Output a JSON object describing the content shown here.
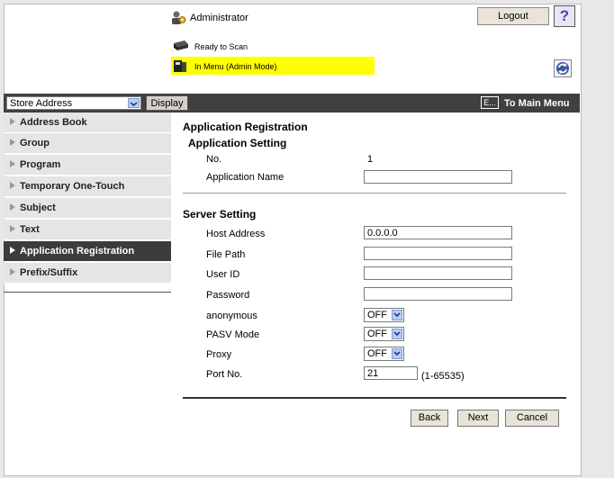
{
  "header": {
    "user_label": "Administrator",
    "logout_label": "Logout",
    "help_label": "?",
    "status_ready": "Ready to Scan",
    "status_mode": "In Menu (Admin Mode)"
  },
  "toolbar": {
    "store_select_value": "Store Address",
    "display_label": "Display",
    "menu_icon_label": "E...",
    "to_main_menu_label": "To Main Menu"
  },
  "sidebar": {
    "items": [
      {
        "label": "Address Book"
      },
      {
        "label": "Group"
      },
      {
        "label": "Program"
      },
      {
        "label": "Temporary One-Touch"
      },
      {
        "label": "Subject"
      },
      {
        "label": "Text"
      },
      {
        "label": "Application Registration",
        "active": true
      },
      {
        "label": "Prefix/Suffix"
      }
    ]
  },
  "main": {
    "title": "Application Registration",
    "application_setting": {
      "heading": "Application Setting",
      "no_label": "No.",
      "no_value": "1",
      "app_name_label": "Application Name",
      "app_name_value": ""
    },
    "server_setting": {
      "heading": "Server Setting",
      "host_label": "Host Address",
      "host_value": "0.0.0.0",
      "file_path_label": "File Path",
      "file_path_value": "",
      "user_id_label": "User ID",
      "user_id_value": "",
      "password_label": "Password",
      "password_value": "",
      "anonymous_label": "anonymous",
      "anonymous_value": "OFF",
      "pasv_label": "PASV Mode",
      "pasv_value": "OFF",
      "proxy_label": "Proxy",
      "proxy_value": "OFF",
      "port_label": "Port No.",
      "port_value": "21",
      "port_range": "(1-65535)"
    },
    "buttons": {
      "back": "Back",
      "next": "Next",
      "cancel": "Cancel"
    }
  },
  "colors": {
    "status_highlight": "#ffff00",
    "dark_bar": "#404040",
    "sidebar_active": "#3c3c3c"
  }
}
